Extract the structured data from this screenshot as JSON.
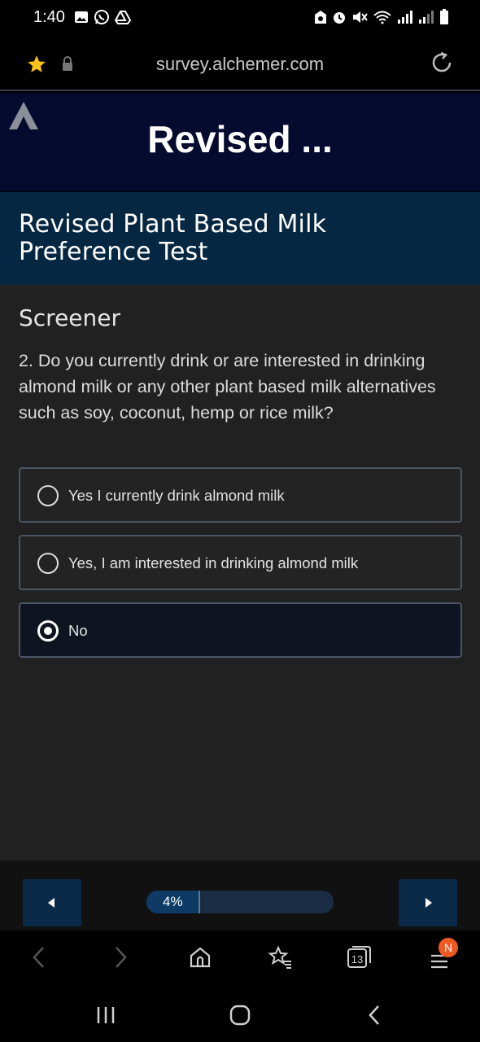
{
  "status_bar": {
    "time": "1:40"
  },
  "browser": {
    "url": "survey.alchemer.com",
    "tab_count": "13",
    "menu_badge": "N"
  },
  "survey": {
    "banner_title": "Revised ...",
    "title": "Revised Plant Based Milk Preference Test",
    "section": "Screener",
    "question": "2. Do you currently drink or are interested in drinking almond milk or any other plant based milk alternatives such as soy, coconut, hemp or rice milk?",
    "options": [
      {
        "label": "Yes I currently drink almond milk",
        "selected": false
      },
      {
        "label": "Yes, I am interested in drinking almond milk",
        "selected": false
      },
      {
        "label": "No",
        "selected": true
      }
    ],
    "progress_label": "4%",
    "progress_fraction": 0.04
  },
  "colors": {
    "banner": "#050b2e",
    "title_band": "#062742",
    "content_bg": "#212121",
    "nav_button": "#0a2a48",
    "badge": "#ee5a24",
    "star": "#f7c21a"
  },
  "icons": {
    "star": "star-icon",
    "lock": "lock-icon",
    "reload": "reload-icon",
    "logo": "alchemer-logo-icon",
    "back": "back-arrow-icon",
    "forward": "forward-arrow-icon",
    "home": "home-icon",
    "bookmarks": "bookmark-star-icon",
    "tabs": "tabs-icon",
    "menu": "menu-icon"
  }
}
